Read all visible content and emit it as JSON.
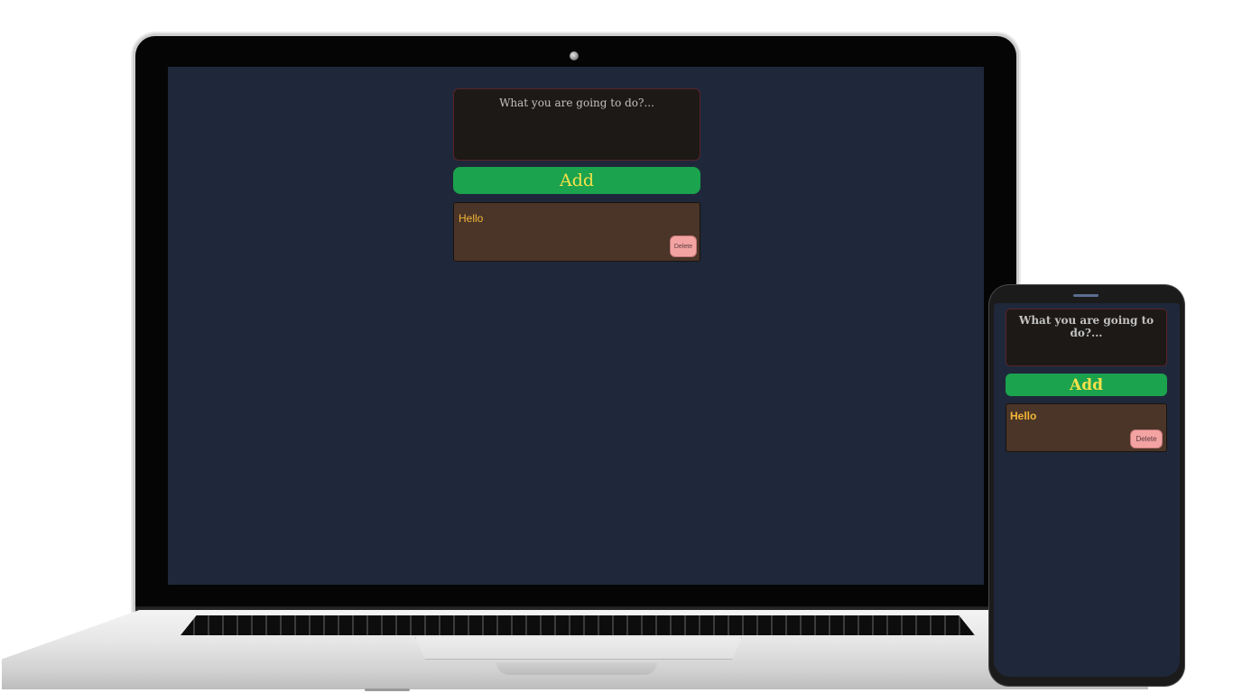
{
  "laptop_app": {
    "input_placeholder": "What you are going to do?...",
    "add_label": "Add",
    "tasks": [
      {
        "text": "Hello",
        "delete_label": "Delete"
      }
    ]
  },
  "phone_app": {
    "input_placeholder": "What you are going to do?...",
    "add_label": "Add",
    "tasks": [
      {
        "text": "Hello",
        "delete_label": "Delete"
      }
    ]
  },
  "colors": {
    "screen_background": "#1f283a",
    "input_background": "#1c1917",
    "add_button": "#1ba34e",
    "add_label": "#f5e14a",
    "task_card": "#4a3528",
    "task_text": "#f3b536",
    "delete_button": "#f4a3a3"
  }
}
